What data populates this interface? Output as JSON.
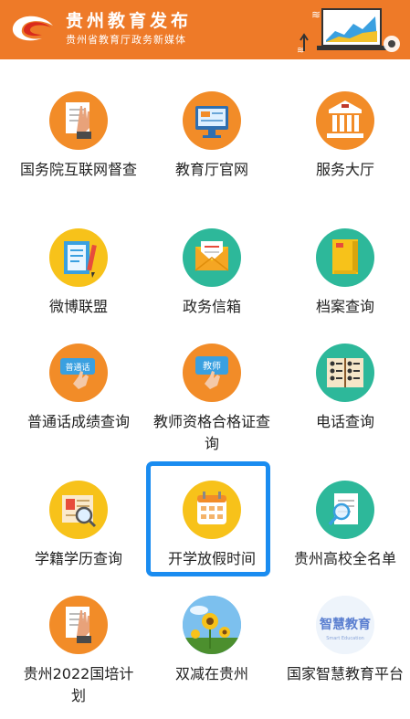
{
  "banner": {
    "title": "贵州教育发布",
    "subtitle": "贵州省教育厅政务新媒体",
    "logo_icon": "brush-swoosh-logo-icon",
    "art_icon": "laptop-chart-illustration-icon",
    "background_color": "#ee7a28"
  },
  "grid": {
    "items": [
      {
        "label": "国务院互联网督查",
        "icon": "hand-document-icon",
        "bg": "#f28c28"
      },
      {
        "label": "教育厅官网",
        "icon": "monitor-icon",
        "bg": "#f28c28"
      },
      {
        "label": "服务大厅",
        "icon": "bank-building-icon",
        "bg": "#f28c28"
      },
      {
        "label": "微博联盟",
        "icon": "notebook-pencil-icon",
        "bg": "#f7c21a"
      },
      {
        "label": "政务信箱",
        "icon": "envelope-icon",
        "bg": "#2db89a"
      },
      {
        "label": "档案查询",
        "icon": "folder-file-icon",
        "bg": "#2db89a"
      },
      {
        "label": "普通话成绩查询",
        "icon": "speech-hand-icon",
        "bg": "#f28c28",
        "badge": "普通话"
      },
      {
        "label": "教师资格合格证查询",
        "icon": "teacher-sign-icon",
        "bg": "#f28c28",
        "badge": "教师"
      },
      {
        "label": "电话查询",
        "icon": "phone-book-icon",
        "bg": "#2db89a"
      },
      {
        "label": "学籍学历查询",
        "icon": "certificate-magnifier-icon",
        "bg": "#f7c21a"
      },
      {
        "label": "开学放假时间",
        "icon": "calendar-icon",
        "bg": "#f7c21a"
      },
      {
        "label": "贵州高校全名单",
        "icon": "document-magnifier-icon",
        "bg": "#2db89a"
      },
      {
        "label": "贵州2022国培计划",
        "icon": "hand-document-icon",
        "bg": "#f28c28"
      },
      {
        "label": "双减在贵州",
        "icon": "sunflower-photo-icon",
        "bg": "#6fb6e8"
      },
      {
        "label": "国家智慧教育平台",
        "icon": "smart-education-logo-icon",
        "bg": "#eef4fb",
        "logo_text": "智慧教育",
        "logo_sub": "Smart Education"
      }
    ]
  },
  "selection": {
    "selected_label": "开学放假时间",
    "color": "#1a8cf0"
  }
}
